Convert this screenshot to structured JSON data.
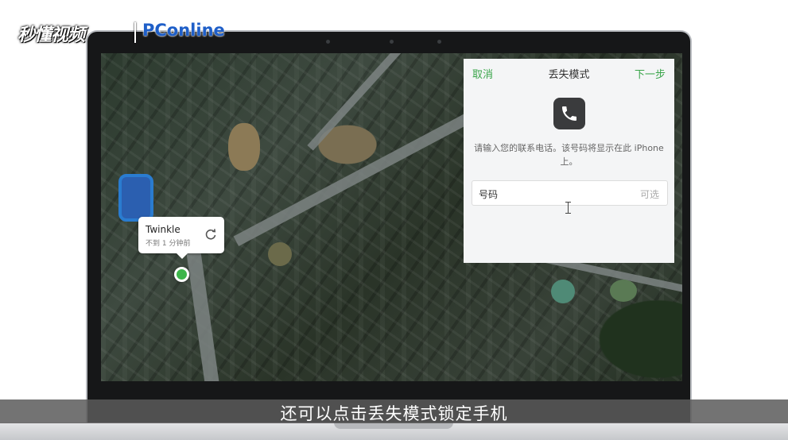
{
  "watermark": {
    "left_text": "秒懂视频",
    "right_text": "PConline",
    "right_color": "#1f5fc8"
  },
  "map": {
    "popup": {
      "name": "Twinkle",
      "time": "不到 1 分钟前",
      "icon": "refresh-icon"
    },
    "marker_color": "#3cb54a"
  },
  "lost_mode": {
    "cancel_label": "取消",
    "title": "丢失模式",
    "next_label": "下一步",
    "icon": "phone-icon",
    "description": "请输入您的联系电话。该号码将显示在此 iPhone 上。",
    "field": {
      "label": "号码",
      "value": "",
      "hint": "可选"
    },
    "accent_color": "#3aa54a"
  },
  "subtitle": "还可以点击丢失模式锁定手机"
}
